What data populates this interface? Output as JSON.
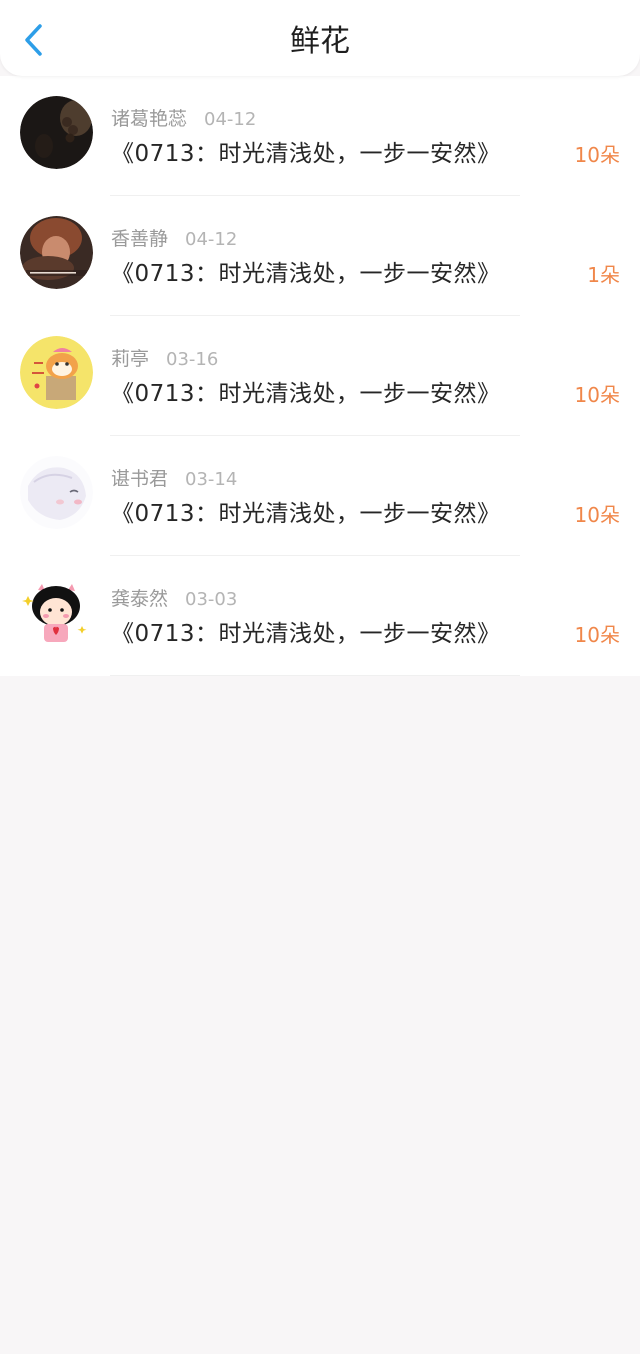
{
  "header": {
    "title": "鲜花"
  },
  "items": [
    {
      "name": "诸葛艳蕊",
      "date": "04-12",
      "work": "《0713：时光清浅处，一步一安然》",
      "count": "10朵"
    },
    {
      "name": "香善静",
      "date": "04-12",
      "work": "《0713：时光清浅处，一步一安然》",
      "count": "1朵"
    },
    {
      "name": "莉亭",
      "date": "03-16",
      "work": "《0713：时光清浅处，一步一安然》",
      "count": "10朵"
    },
    {
      "name": "谌书君",
      "date": "03-14",
      "work": "《0713：时光清浅处，一步一安然》",
      "count": "10朵"
    },
    {
      "name": "龚泰然",
      "date": "03-03",
      "work": "《0713：时光清浅处，一步一安然》",
      "count": "10朵"
    }
  ],
  "colors": {
    "accent": "#2d9ee8",
    "count": "#f0874a",
    "background": "#f8f6f7"
  }
}
